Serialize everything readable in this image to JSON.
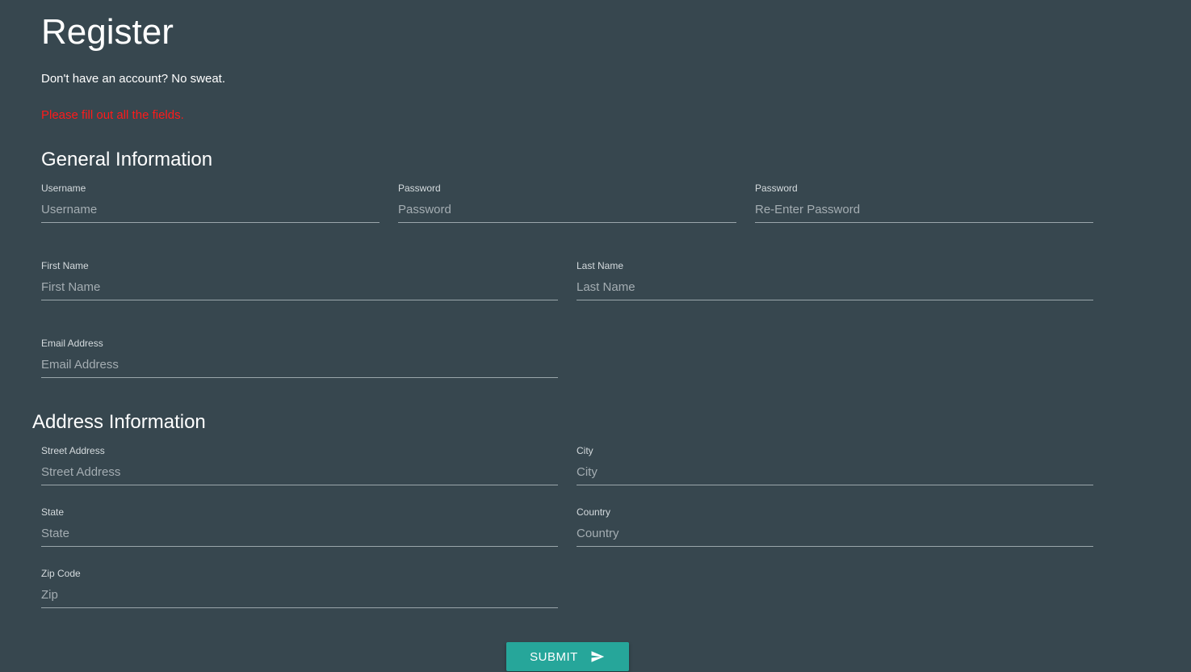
{
  "header": {
    "title": "Register",
    "subtitle": "Don't have an account? No sweat.",
    "error": "Please fill out all the fields."
  },
  "general": {
    "title": "General Information",
    "username": {
      "label": "Username",
      "placeholder": "Username"
    },
    "password": {
      "label": "Password",
      "placeholder": "Password"
    },
    "password_confirm": {
      "label": "Password",
      "placeholder": "Re-Enter Password"
    },
    "first_name": {
      "label": "First Name",
      "placeholder": "First Name"
    },
    "last_name": {
      "label": "Last Name",
      "placeholder": "Last Name"
    },
    "email": {
      "label": "Email Address",
      "placeholder": "Email Address"
    }
  },
  "address": {
    "title": "Address Information",
    "street": {
      "label": "Street Address",
      "placeholder": "Street Address"
    },
    "city": {
      "label": "City",
      "placeholder": "City"
    },
    "state": {
      "label": "State",
      "placeholder": "State"
    },
    "country": {
      "label": "Country",
      "placeholder": "Country"
    },
    "zip": {
      "label": "Zip Code",
      "placeholder": "Zip"
    }
  },
  "submit": {
    "label": "SUBMIT",
    "icon": "send-icon"
  },
  "colors": {
    "background": "#37474f",
    "accent": "#26a69a",
    "error": "#ff1a1a"
  }
}
